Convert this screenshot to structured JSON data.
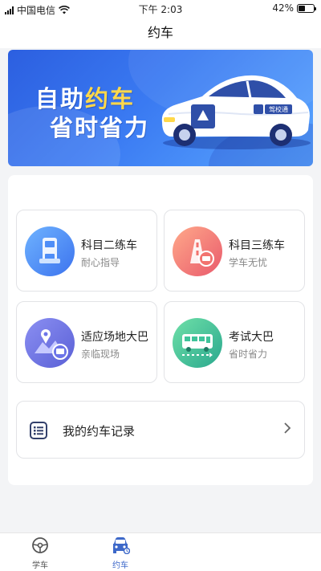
{
  "status_bar": {
    "carrier": "中国电信",
    "time": "下午 2:03",
    "battery_percent": "42%",
    "battery_level": 0.42
  },
  "nav": {
    "title": "约车"
  },
  "banner": {
    "line1_prefix": "自助",
    "line1_highlight": "约车",
    "line2": "省时省力",
    "car_sign": "驾校通",
    "accent_color": "#ffd84a"
  },
  "services": [
    {
      "title": "科目二练车",
      "subtitle": "耐心指导",
      "icon": "subject2-car-icon",
      "color": "#4f8ef7"
    },
    {
      "title": "科目三练车",
      "subtitle": "学车无忧",
      "icon": "subject3-road-icon",
      "color": "#f2736f"
    },
    {
      "title": "适应场地大巴",
      "subtitle": "亲临现场",
      "icon": "venue-bus-icon",
      "color": "#6c74e8"
    },
    {
      "title": "考试大巴",
      "subtitle": "省时省力",
      "icon": "exam-bus-icon",
      "color": "#3fc39a"
    }
  ],
  "record": {
    "label": "我的约车记录",
    "icon": "list-icon"
  },
  "tab_bar": {
    "items": [
      {
        "label": "学车",
        "icon": "steering-wheel-icon",
        "active": false
      },
      {
        "label": "约车",
        "icon": "car-front-icon",
        "active": true
      }
    ],
    "active_color": "#3d68c9"
  }
}
